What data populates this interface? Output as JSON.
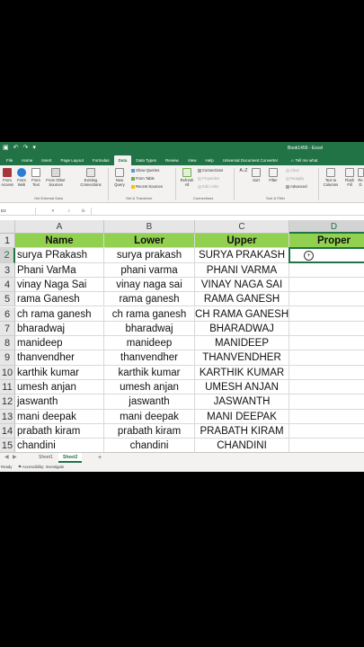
{
  "window": {
    "title": "Book1456 - Excel"
  },
  "quick_access": {
    "save_icon": "save-icon",
    "undo_icon": "undo-icon",
    "redo_icon": "redo-icon"
  },
  "tabs": [
    "File",
    "Home",
    "Insert",
    "Page Layout",
    "Formulas",
    "Data",
    "Data Types",
    "Review",
    "View",
    "Help",
    "Universal Document Converter"
  ],
  "active_tab": "Data",
  "tell_me": "Tell me what",
  "ribbon": {
    "from_access": "From Access",
    "from_web": "From Web",
    "from_text": "From Text",
    "from_other_sources": "From Other Sources",
    "existing_connections": "Existing Connections",
    "group_external": "Get External Data",
    "new_query": "New Query",
    "show_queries": "Show Queries",
    "from_table": "From Table",
    "recent_sources": "Recent Sources",
    "group_transform": "Get & Transform",
    "refresh_all": "Refresh All",
    "connections": "Connections",
    "properties": "Properties",
    "edit_links": "Edit Links",
    "group_connections": "Connections",
    "sort_az": "A↓Z",
    "sort": "Sort",
    "filter": "Filter",
    "clear": "Clear",
    "reapply": "Reapply",
    "advanced": "Advanced",
    "group_sort_filter": "Sort & Filter",
    "text_to_columns": "Text to Columns",
    "flash_fill": "Flash Fill",
    "remove_dupes": "Re D"
  },
  "formula_bar": {
    "name_box": "D2",
    "cancel": "✕",
    "enter": "✓",
    "fx": "fx",
    "value": ""
  },
  "columns": [
    "A",
    "B",
    "C",
    "D"
  ],
  "selected_column": "D",
  "rows": [
    "1",
    "2",
    "3",
    "4",
    "5",
    "6",
    "7",
    "8",
    "9",
    "10",
    "11",
    "12",
    "13",
    "14",
    "15"
  ],
  "selected_row": "2",
  "table": {
    "headers": [
      "Name",
      "Lower",
      "Upper",
      "Proper"
    ],
    "data": [
      [
        "surya PRakash",
        "surya prakash",
        "SURYA PRAKASH",
        ""
      ],
      [
        "Phani VarMa",
        "phani varma",
        "PHANI VARMA",
        ""
      ],
      [
        "vinay Naga Sai",
        "vinay naga sai",
        "VINAY NAGA SAI",
        ""
      ],
      [
        "rama Ganesh",
        "rama ganesh",
        "RAMA GANESH",
        ""
      ],
      [
        "ch rama ganesh",
        "ch rama ganesh",
        "CH RAMA GANESH",
        ""
      ],
      [
        "bharadwaj",
        "bharadwaj",
        "BHARADWAJ",
        ""
      ],
      [
        "manideep",
        "manideep",
        "MANIDEEP",
        ""
      ],
      [
        "thanvendher",
        "thanvendher",
        "THANVENDHER",
        ""
      ],
      [
        "karthik kumar",
        "karthik kumar",
        "KARTHIK KUMAR",
        ""
      ],
      [
        "umesh anjan",
        "umesh anjan",
        "UMESH ANJAN",
        ""
      ],
      [
        "jaswanth",
        "jaswanth",
        "JASWANTH",
        ""
      ],
      [
        "mani deepak",
        "mani deepak",
        "MANI DEEPAK",
        ""
      ],
      [
        "prabath kiram",
        "prabath kiram",
        "PRABATH KIRAM",
        ""
      ],
      [
        "chandini",
        "chandini",
        "CHANDINI",
        ""
      ]
    ]
  },
  "sheets": [
    "Sheet1",
    "Sheet2"
  ],
  "active_sheet": "Sheet2",
  "add_sheet": "+",
  "status": {
    "ready": "Ready",
    "accessibility": "Accessibility: Investigate"
  },
  "colors": {
    "excel_green": "#217346",
    "header_fill": "#92d050"
  }
}
